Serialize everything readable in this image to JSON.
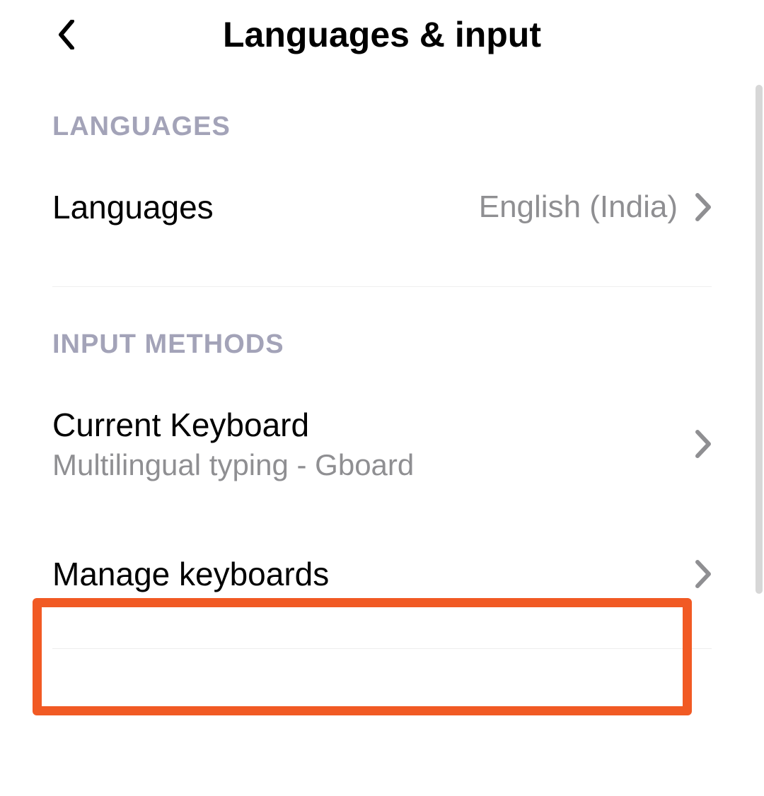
{
  "header": {
    "title": "Languages & input"
  },
  "sections": {
    "languages": {
      "header": "LANGUAGES",
      "row": {
        "label": "Languages",
        "value": "English (India)"
      }
    },
    "input_methods": {
      "header": "INPUT METHODS",
      "current_keyboard": {
        "label": "Current Keyboard",
        "sub": "Multilingual typing - Gboard"
      },
      "manage_keyboards": {
        "label": "Manage keyboards"
      }
    }
  }
}
